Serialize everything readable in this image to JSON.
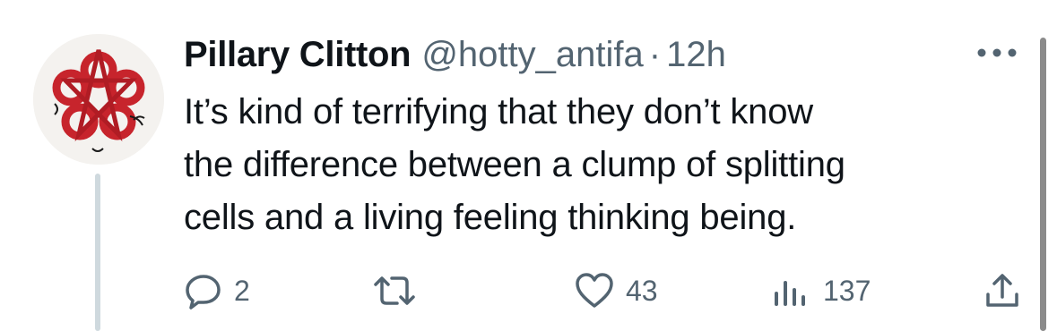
{
  "tweet": {
    "display_name": "Pillary Clitton",
    "handle": "@hotty_antifa",
    "separator": "·",
    "time": "12h",
    "text": "It’s kind of terrifying that they don’t know\nthe difference between a clump of splitting\ncells and a living feeling thinking being."
  },
  "actions": {
    "reply_count": "2",
    "retweet_count": "",
    "like_count": "43",
    "views_count": "137"
  },
  "icons": {
    "more": "more-horizontal-icon",
    "reply": "reply-icon",
    "retweet": "retweet-icon",
    "like": "heart-icon",
    "views": "views-icon",
    "share": "share-icon"
  },
  "colors": {
    "text_primary": "#0f1419",
    "text_secondary": "#536471",
    "thread_line": "#cfd9de",
    "avatar_red": "#c7242c"
  }
}
